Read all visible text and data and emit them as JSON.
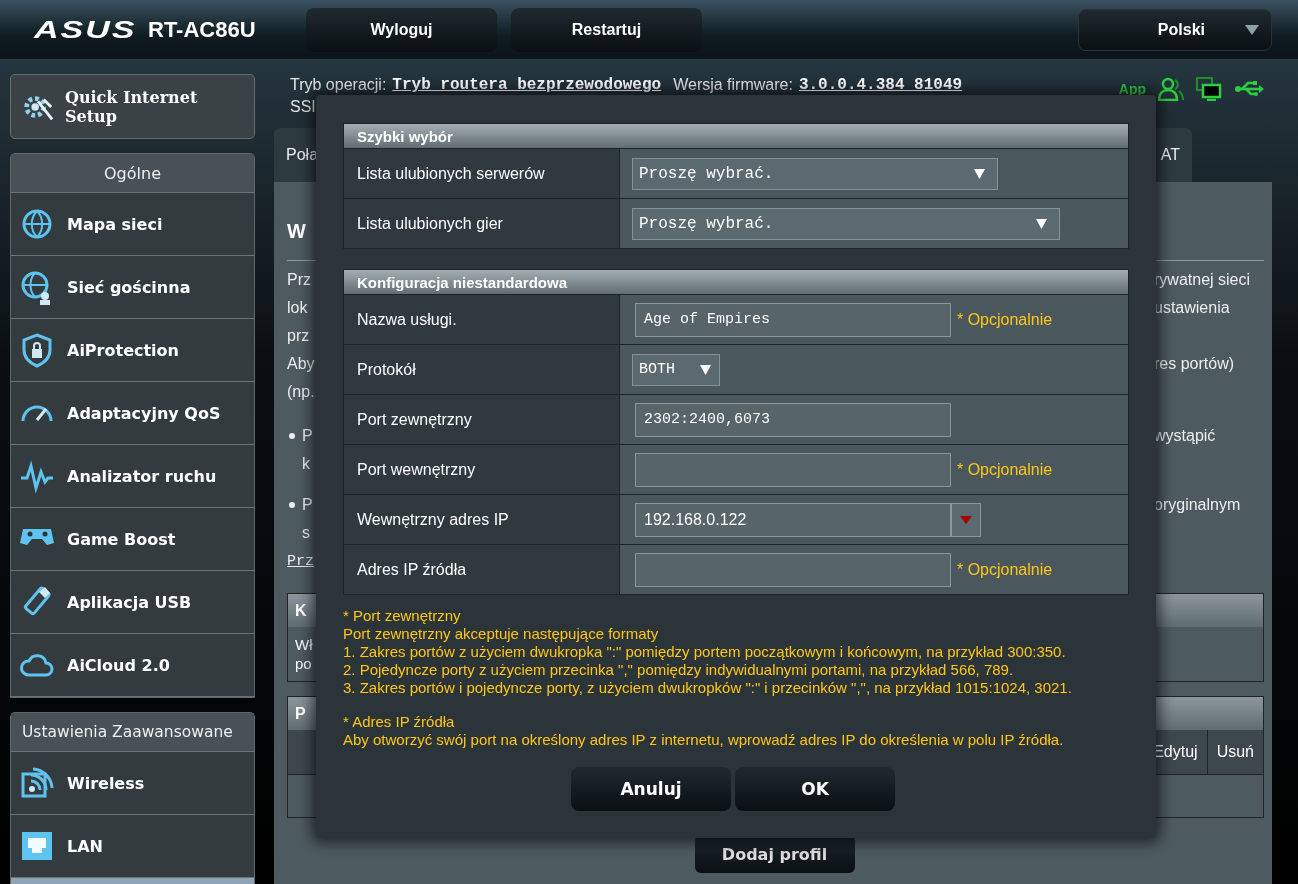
{
  "header": {
    "logo": "ASUS",
    "model": "RT-AC86U",
    "buttons": [
      "Wyloguj",
      "Restartuj"
    ],
    "language": "Polski"
  },
  "sidebar": {
    "quick_setup": "Quick Internet Setup",
    "sections": [
      {
        "title": "Ogólne",
        "items": [
          "Mapa sieci",
          "Sieć gościnna",
          "AiProtection",
          "Adaptacyjny QoS",
          "Analizator ruchu",
          "Game Boost",
          "Aplikacja USB",
          "AiCloud 2.0"
        ]
      },
      {
        "title": "Ustawienia Zaawansowane",
        "items": [
          "Wireless",
          "LAN"
        ]
      }
    ]
  },
  "status": {
    "mode_label": "Tryb operacji:",
    "mode": "Tryb routera bezprzewodowego",
    "firmware_label": "Wersja firmware:",
    "firmware": "3.0.0.4.384_81049",
    "ssid_label": "SSI",
    "app": "App"
  },
  "tabs": [
    {
      "label": "Poła",
      "selected": false
    },
    {
      "label": "AT",
      "selected": false
    }
  ],
  "page": {
    "heading": "W",
    "lines": [
      {
        "left": "Prz",
        "right": "rywatnej sieci"
      },
      {
        "left": "lok",
        "right": "ustawienia"
      },
      {
        "left": "prz"
      },
      {
        "left": "Aby",
        "right": "res portów)"
      },
      {
        "left": "(np."
      }
    ],
    "bullets": [
      [
        {
          "left": "P",
          "right": "wystąpić"
        },
        {
          "left": "k"
        }
      ],
      [
        {
          "left": "P",
          "right": "oryginalnym"
        },
        {
          "left": "s"
        }
      ]
    ],
    "link": "Prz",
    "table1": {
      "title": "K",
      "lines": [
        "Wł",
        "po"
      ]
    },
    "table2": {
      "title": "P",
      "right_columns": [
        "Edytuj",
        "Usuń"
      ]
    },
    "add_button": "Dodaj profil"
  },
  "modal": {
    "quick_pick": {
      "title": "Szybki wybór",
      "rows": [
        {
          "label": "Lista ulubionych serwerów",
          "value": "Proszę wybrać."
        },
        {
          "label": "Lista ulubionych gier",
          "value": "Proszę wybrać."
        }
      ]
    },
    "custom": {
      "title": "Konfiguracja niestandardowa",
      "rows": [
        {
          "kind": "text",
          "label": "Nazwa usługi.",
          "value": "Age of Empires",
          "hint": "* Opcjonalnie"
        },
        {
          "kind": "select",
          "label": "Protokół",
          "value": "BOTH"
        },
        {
          "kind": "text",
          "label": "Port zewnętrzny",
          "value": "2302:2400,6073"
        },
        {
          "kind": "text",
          "label": "Port wewnętrzny",
          "hint": "* Opcjonalnie"
        },
        {
          "kind": "combo",
          "label": "Wewnętrzny adres IP",
          "value": "192.168.0.122"
        },
        {
          "kind": "text",
          "label": "Adres IP źródła",
          "hint": "* Opcjonalnie"
        }
      ]
    },
    "notes": [
      {
        "title": "* Port zewnętrzny",
        "lines": [
          "Port zewnętrzny akceptuje następujące formaty",
          "1. Zakres portów z użyciem dwukropka \":\" pomiędzy portem początkowym i końcowym, na przykład 300:350.",
          "2. Pojedyncze porty z użyciem przecinka \",\" pomiędzy indywidualnymi portami, na przykład 566, 789.",
          "3. Zakres portów i pojedyncze porty, z użyciem dwukropków \":\" i przecinków \",\", na przykład 1015:1024, 3021."
        ]
      },
      {
        "title": "* Adres IP źródła",
        "lines": [
          "Aby otworzyć swój port na określony adres IP z internetu, wprowadź adres IP do określenia w polu IP źródła."
        ]
      }
    ],
    "buttons": [
      "Anuluj",
      "OK"
    ]
  }
}
